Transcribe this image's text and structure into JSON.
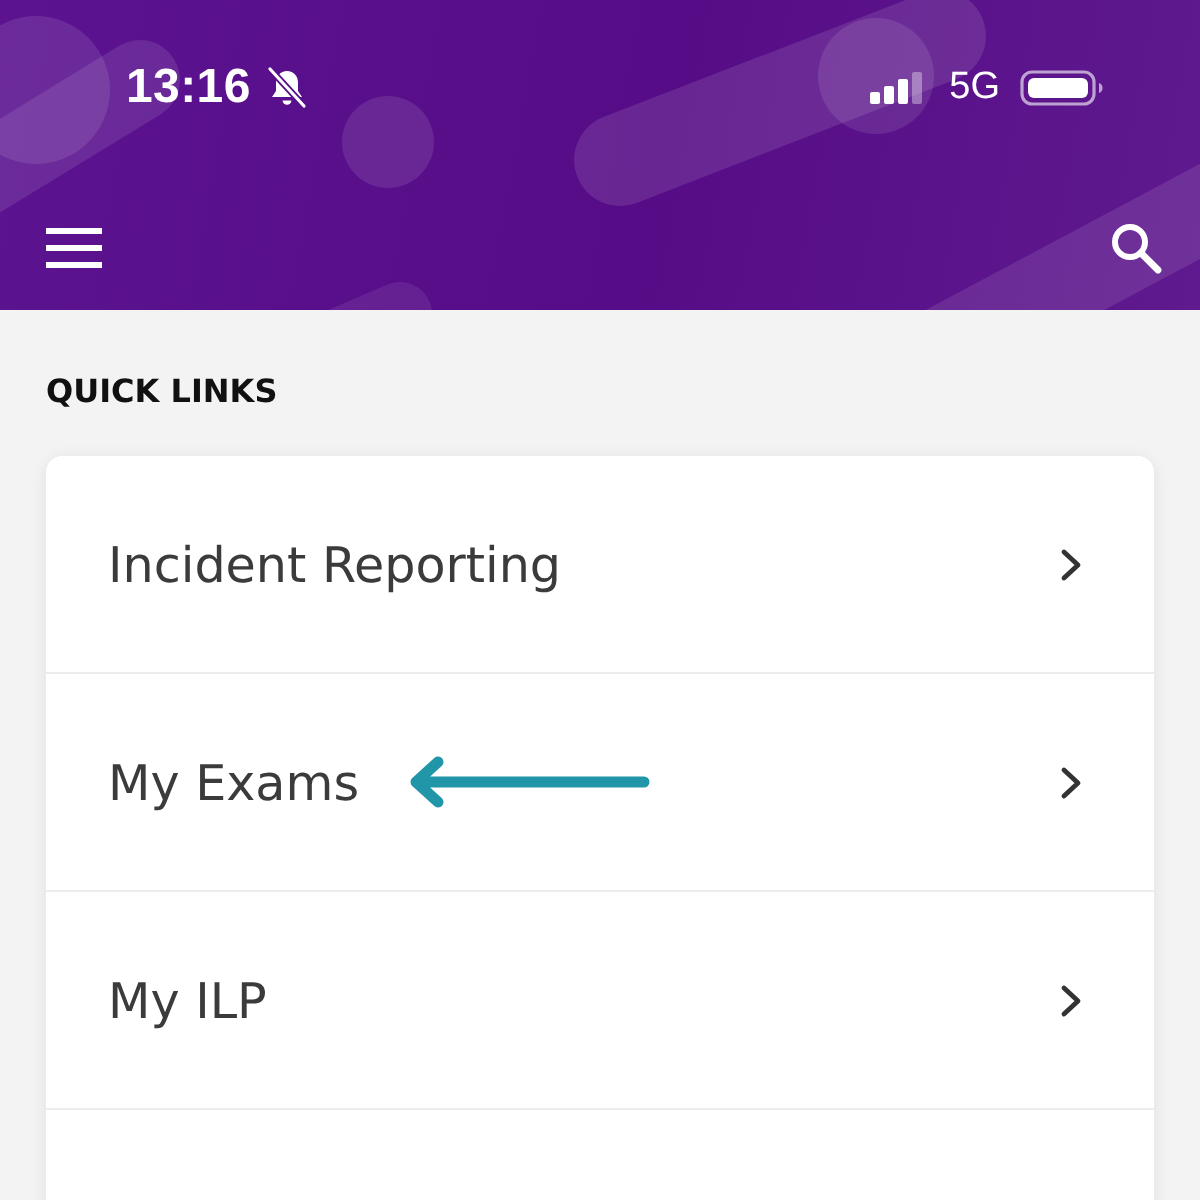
{
  "status_bar": {
    "time": "13:16",
    "silent": true,
    "network": "5G"
  },
  "section": {
    "title": "QUICK LINKS"
  },
  "quick_links": [
    {
      "label": "Incident Reporting",
      "marked": false
    },
    {
      "label": "My Exams",
      "marked": true
    },
    {
      "label": "My ILP",
      "marked": false
    }
  ]
}
